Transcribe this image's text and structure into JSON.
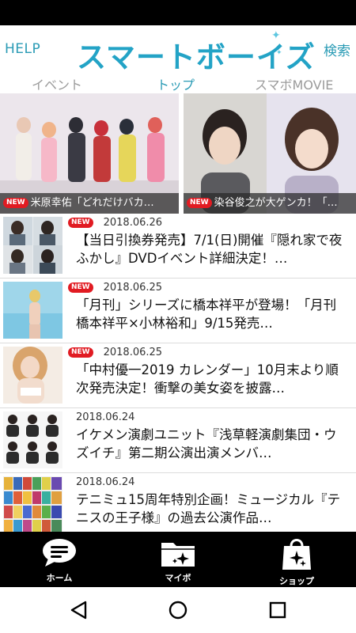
{
  "header": {
    "help_label": "HELP",
    "logo_text": "スマートボーイズ",
    "search_label": "検索"
  },
  "tabs": [
    {
      "label": "イベント",
      "active": false
    },
    {
      "label": "トップ",
      "active": true
    },
    {
      "label": "スマボMOVIE",
      "active": false
    }
  ],
  "featured": [
    {
      "badge": "NEW",
      "caption": "米原幸佑「どれだけバカ…"
    },
    {
      "badge": "NEW",
      "caption": "染谷俊之が大ゲンカ！「…"
    }
  ],
  "news": [
    {
      "badge": "NEW",
      "date": "2018.06.26",
      "title": "【当日引換券発売】7/1(日)開催『隠れ家で夜ふかし』DVDイベント詳細決定！…"
    },
    {
      "badge": "NEW",
      "date": "2018.06.25",
      "title": "「月刊」シリーズに橋本祥平が登場！「月刊 橋本祥平×小林裕和」9/15発売…"
    },
    {
      "badge": "NEW",
      "date": "2018.06.25",
      "title": "「中村優一2019 カレンダー」10月末より順次発売決定！衝撃の美女姿を披露…"
    },
    {
      "badge": "",
      "date": "2018.06.24",
      "title": "イケメン演劇ユニット『浅草軽演劇集団・ウズイチ』第二期公演出演メンバ…"
    },
    {
      "badge": "",
      "date": "2018.06.24",
      "title": "テニミュ15周年特別企画！ミュージカル『テニスの王子様』の過去公演作品…"
    }
  ],
  "bottom_nav": [
    {
      "label": "ホーム",
      "icon": "chat-bubble-icon"
    },
    {
      "label": "マイボ",
      "icon": "folder-sparkle-icon"
    },
    {
      "label": "ショップ",
      "icon": "shopping-bag-icon"
    }
  ],
  "colors": {
    "accent": "#2a9bb5",
    "logo": "#23a3c6",
    "new_badge": "#e11b22"
  }
}
